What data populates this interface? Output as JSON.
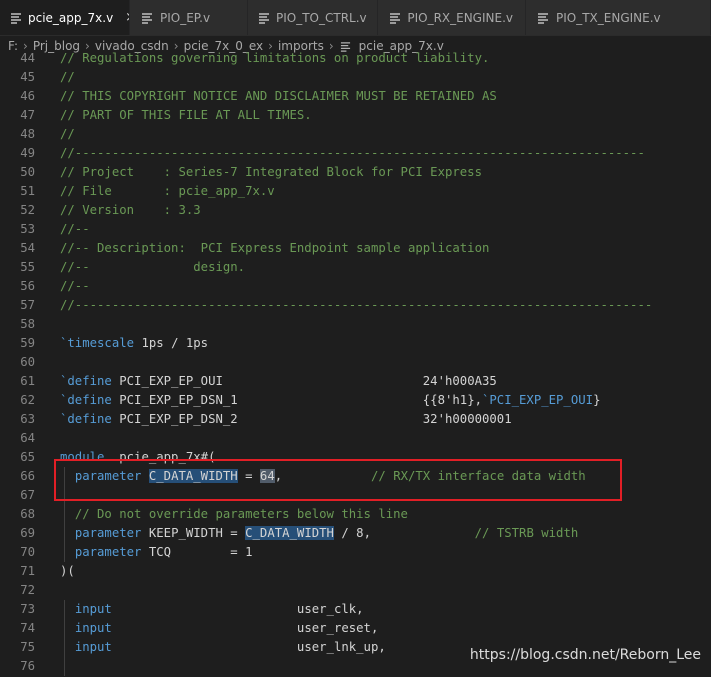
{
  "tabs": [
    {
      "label": "pcie_app_7x.v",
      "active": true,
      "close": "×"
    },
    {
      "label": "PIO_EP.v",
      "active": false
    },
    {
      "label": "PIO_TO_CTRL.v",
      "active": false
    },
    {
      "label": "PIO_RX_ENGINE.v",
      "active": false
    },
    {
      "label": "PIO_TX_ENGINE.v",
      "active": false
    }
  ],
  "breadcrumb": [
    "F:",
    "Prj_blog",
    "vivado_csdn",
    "pcie_7x_0_ex",
    "imports",
    "pcie_app_7x.v"
  ],
  "lines": [
    {
      "n": "44",
      "segs": [
        [
          "c",
          "// Regulations governing limitations on product liability."
        ]
      ]
    },
    {
      "n": "45",
      "segs": [
        [
          "c",
          "//"
        ]
      ]
    },
    {
      "n": "46",
      "segs": [
        [
          "c",
          "// THIS COPYRIGHT NOTICE AND DISCLAIMER MUST BE RETAINED AS"
        ]
      ]
    },
    {
      "n": "47",
      "segs": [
        [
          "c",
          "// PART OF THIS FILE AT ALL TIMES."
        ]
      ]
    },
    {
      "n": "48",
      "segs": [
        [
          "c",
          "//"
        ]
      ]
    },
    {
      "n": "49",
      "segs": [
        [
          "c",
          "//-----------------------------------------------------------------------------"
        ]
      ]
    },
    {
      "n": "50",
      "segs": [
        [
          "c",
          "// Project    : Series-7 Integrated Block for PCI Express"
        ]
      ]
    },
    {
      "n": "51",
      "segs": [
        [
          "c",
          "// File       : pcie_app_7x.v"
        ]
      ]
    },
    {
      "n": "52",
      "segs": [
        [
          "c",
          "// Version    : 3.3"
        ]
      ]
    },
    {
      "n": "53",
      "segs": [
        [
          "c",
          "//--"
        ]
      ]
    },
    {
      "n": "54",
      "segs": [
        [
          "c",
          "//-- Description:  PCI Express Endpoint sample application"
        ]
      ]
    },
    {
      "n": "55",
      "segs": [
        [
          "c",
          "//--              design."
        ]
      ]
    },
    {
      "n": "56",
      "segs": [
        [
          "c",
          "//--"
        ]
      ]
    },
    {
      "n": "57",
      "segs": [
        [
          "c",
          "//------------------------------------------------------------------------------"
        ]
      ]
    },
    {
      "n": "58",
      "segs": []
    },
    {
      "n": "59",
      "segs": [
        [
          "k",
          "`timescale"
        ],
        [
          "t",
          " 1ps / 1ps"
        ]
      ]
    },
    {
      "n": "60",
      "segs": []
    },
    {
      "n": "61",
      "segs": [
        [
          "k",
          "`define"
        ],
        [
          "t",
          " PCI_EXP_EP_OUI                           24'h000A35"
        ]
      ]
    },
    {
      "n": "62",
      "segs": [
        [
          "k",
          "`define"
        ],
        [
          "t",
          " PCI_EXP_EP_DSN_1                         {{8'h1},"
        ],
        [
          "k",
          "`PCI_EXP_EP_OUI"
        ],
        [
          "t",
          "}"
        ]
      ]
    },
    {
      "n": "63",
      "segs": [
        [
          "k",
          "`define"
        ],
        [
          "t",
          " PCI_EXP_EP_DSN_2                         32'h00000001"
        ]
      ]
    },
    {
      "n": "64",
      "segs": []
    },
    {
      "n": "65",
      "segs": [
        [
          "k",
          "module"
        ],
        [
          "t",
          "  pcie_app_7x#("
        ]
      ]
    },
    {
      "n": "66",
      "segs": [
        [
          "t",
          "  "
        ],
        [
          "k",
          "parameter"
        ],
        [
          "t",
          " "
        ],
        [
          "hl",
          "C_DATA_WIDTH"
        ],
        [
          "t",
          " = "
        ],
        [
          "hl2",
          "64"
        ],
        [
          "t",
          ",            "
        ],
        [
          "c",
          "// RX/TX interface data width"
        ]
      ]
    },
    {
      "n": "67",
      "segs": []
    },
    {
      "n": "68",
      "segs": [
        [
          "t",
          "  "
        ],
        [
          "c",
          "// Do not override parameters below this line"
        ]
      ]
    },
    {
      "n": "69",
      "segs": [
        [
          "t",
          "  "
        ],
        [
          "k",
          "parameter"
        ],
        [
          "t",
          " KEEP_WIDTH = "
        ],
        [
          "hl",
          "C_DATA_WIDTH"
        ],
        [
          "t",
          " / 8,              "
        ],
        [
          "c",
          "// TSTRB width"
        ]
      ]
    },
    {
      "n": "70",
      "segs": [
        [
          "t",
          "  "
        ],
        [
          "k",
          "parameter"
        ],
        [
          "t",
          " TCQ        = 1"
        ]
      ]
    },
    {
      "n": "71",
      "segs": [
        [
          "t",
          ")("
        ]
      ]
    },
    {
      "n": "72",
      "segs": []
    },
    {
      "n": "73",
      "segs": [
        [
          "t",
          "  "
        ],
        [
          "k",
          "input"
        ],
        [
          "t",
          "                         user_clk,"
        ]
      ]
    },
    {
      "n": "74",
      "segs": [
        [
          "t",
          "  "
        ],
        [
          "k",
          "input"
        ],
        [
          "t",
          "                         user_reset,"
        ]
      ]
    },
    {
      "n": "75",
      "segs": [
        [
          "t",
          "  "
        ],
        [
          "k",
          "input"
        ],
        [
          "t",
          "                         user_lnk_up,"
        ]
      ]
    },
    {
      "n": "76",
      "segs": []
    }
  ],
  "watermark": "https://blog.csdn.net/Reborn_Lee",
  "colors": {
    "comment": "#6a9955",
    "keyword": "#569cd6",
    "highlight_box": "#e21f26"
  },
  "icons": {
    "file": "verilog-file-icon",
    "close": "close-icon",
    "breadcrumb_sep": "chevron-right-icon"
  }
}
